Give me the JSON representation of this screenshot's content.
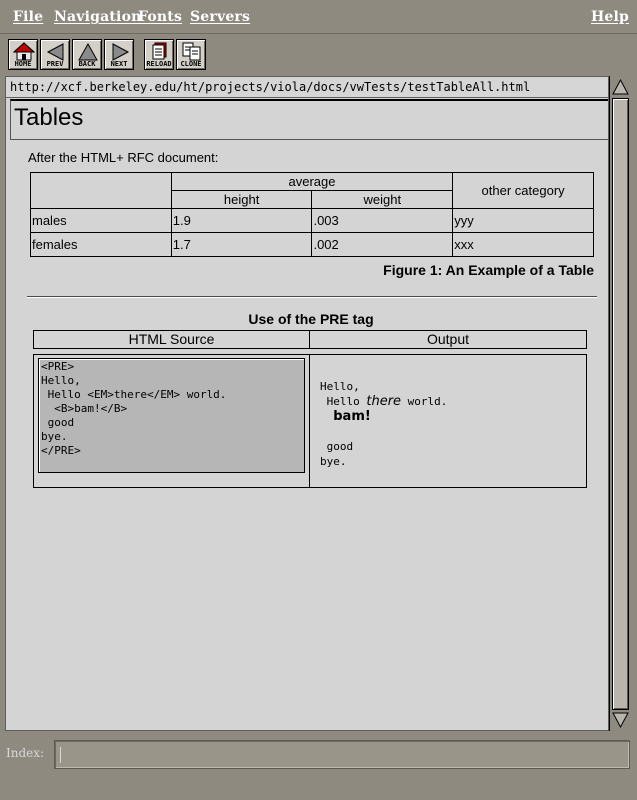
{
  "menu": {
    "file": "File",
    "navigation": "Navigation",
    "fonts": "Fonts",
    "servers": "Servers",
    "help": "Help"
  },
  "toolbar": {
    "home": "HOME",
    "prev": "PREV",
    "back": "BACK",
    "next": "NEXT",
    "reload": "RELOAD",
    "clone": "CLONE",
    "logo_icon": "viola-logo-icon"
  },
  "url": "http://xcf.berkeley.edu/ht/projects/viola/docs/vwTests/testTableAll.html",
  "document": {
    "title": "Tables",
    "intro": "After the HTML+ RFC document:",
    "table": {
      "group_header": "average",
      "height_header": "height",
      "weight_header": "weight",
      "other_header": "other category",
      "rows": [
        {
          "label": "males",
          "height": "1.9",
          "weight": ".003",
          "other": "yyy"
        },
        {
          "label": "females",
          "height": "1.7",
          "weight": ".002",
          "other": "xxx"
        }
      ]
    },
    "figure_caption": "Figure 1: An Example of a Table",
    "pre_section_title": "Use of the PRE tag",
    "source_header": "HTML Source",
    "output_header": "Output",
    "source_lines": [
      "<PRE>",
      "Hello,",
      " Hello <EM>there</EM> world.",
      "  <B>bam!</B>",
      "",
      " good",
      "bye.",
      "</PRE>"
    ],
    "output": {
      "line1": "Hello,",
      "line2_prefix": " Hello ",
      "line2_em": "there",
      "line2_suffix": " world.",
      "line3_prefix": "  ",
      "line3_bold": "bam!",
      "line5": " good",
      "line6": "bye."
    }
  },
  "index_label": "Index:",
  "colors": {
    "chrome": "#8f8a7f",
    "document_bg": "#d4d4d4",
    "pre_bg": "#b6b6b6"
  }
}
